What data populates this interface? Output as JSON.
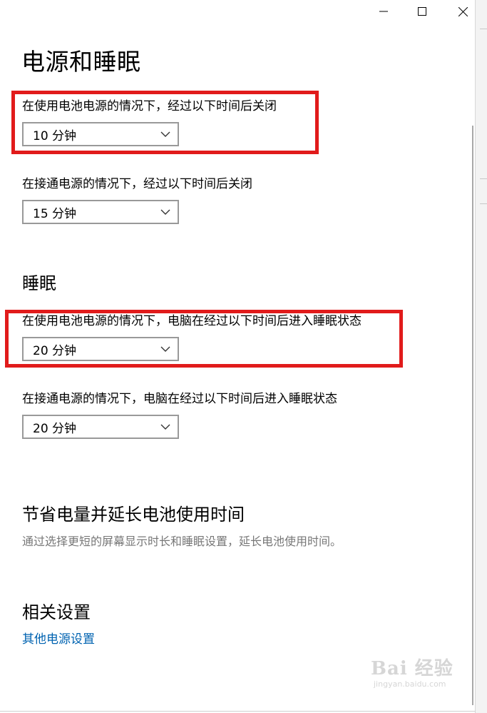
{
  "window": {
    "title": "电源和睡眠",
    "controls": {
      "minimize_icon": "minimize-icon",
      "maximize_icon": "maximize-icon",
      "close_icon": "close-icon"
    }
  },
  "screen": {
    "section_title": "",
    "battery_label": "在使用电池电源的情况下，经过以下时间后关闭",
    "battery_value": "10 分钟",
    "plugged_label": "在接通电源的情况下，经过以下时间后关闭",
    "plugged_value": "15 分钟"
  },
  "sleep": {
    "title": "睡眠",
    "battery_label": "在使用电池电源的情况下，电脑在经过以下时间后进入睡眠状态",
    "battery_value": "20 分钟",
    "plugged_label": "在接通电源的情况下，电脑在经过以下时间后进入睡眠状态",
    "plugged_value": "20 分钟"
  },
  "save_energy": {
    "title": "节省电量并延长电池使用时间",
    "description": "通过选择更短的屏幕显示时长和睡眠设置，延长电池使用时间。"
  },
  "related": {
    "title": "相关设置",
    "link": "其他电源设置"
  },
  "watermark": {
    "logo": "Bai 经验",
    "url": "jingyan.baidu.com"
  },
  "colors": {
    "highlight": "#e11b1b",
    "link": "#0063b1",
    "dropdown_border": "#999999",
    "description": "#777777"
  }
}
